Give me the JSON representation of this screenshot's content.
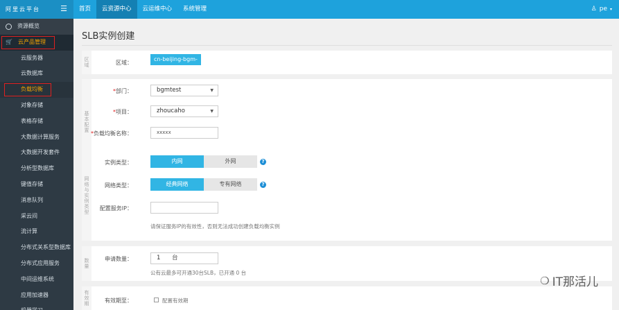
{
  "topbar": {
    "brand": "阿里云平台",
    "nav": [
      "首页",
      "云资源中心",
      "云运维中心",
      "系统管理"
    ],
    "active_nav": 1,
    "user": "pe"
  },
  "sidebar": {
    "top_item": "资源概览",
    "group": "云产品管理",
    "items": [
      "云服务器",
      "云数据库",
      "负载均衡",
      "对象存储",
      "表格存储",
      "大数据计算服务",
      "大数据开发套件",
      "分析型数据库",
      "键值存储",
      "消息队列",
      "采云间",
      "流计算",
      "分布式关系型数据库",
      "分布式应用服务",
      "中间运维系统",
      "应用加速器",
      "机器学习"
    ]
  },
  "page": {
    "title": "SLB实例创建",
    "section_region": "区域",
    "section_basic": "基本配置",
    "section_network": "网络与实例类型",
    "section_count": "数量",
    "section_period": "有效期"
  },
  "form": {
    "region_label": "区域：",
    "region_value": "cn-beijing-bgm-",
    "dept_label": "部门：",
    "dept_value": "bgmtest",
    "project_label": "项目：",
    "project_value": "zhoucaho",
    "name_label": "负载均衡名称：",
    "name_value": "xxxxx",
    "instance_type_label": "实例类型：",
    "instance_type_options": [
      "内网",
      "外网"
    ],
    "network_type_label": "网络类型：",
    "network_type_options": [
      "经典网络",
      "专有网络"
    ],
    "service_ip_label": "配置服务IP：",
    "service_ip_hint": "请保证服务IP的有效性，否则无法成功创建负载均衡实例",
    "quantity_label": "申请数量：",
    "quantity_value": "1",
    "quantity_unit": "台",
    "quantity_hint": "公有云最多可开通30台SLB，已开通 0 台",
    "period_label": "有效期至：",
    "period_checkbox": "配置有效期"
  },
  "watermark": "IT那活儿"
}
